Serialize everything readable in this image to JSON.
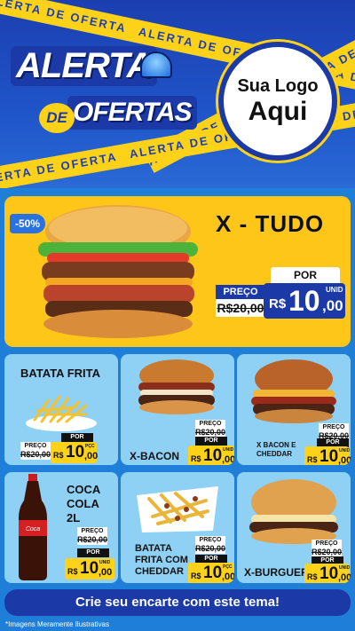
{
  "header": {
    "tape_text": "ALERTA DE OFERTA",
    "title_line1": "ALERTA",
    "title_de": "DE",
    "title_line2": "OFERTAS",
    "logo_line1": "Sua Logo",
    "logo_line2": "Aqui"
  },
  "featured": {
    "discount": "-50%",
    "name": "X - TUDO",
    "por_label": "POR",
    "preco_label": "PREÇO",
    "old_price": "R$20,00",
    "currency": "R$",
    "price_int": "10",
    "price_cents": ",00",
    "unit": "UNID"
  },
  "products": [
    {
      "name": "BATATA FRITA",
      "preco_label": "PREÇO",
      "old_price": "R$20,00",
      "por_label": "POR",
      "currency": "R$",
      "price_int": "10",
      "price_cents": ",00",
      "unit": "PÇC"
    },
    {
      "name": "X-BACON",
      "preco_label": "PREÇO",
      "old_price": "R$20,00",
      "por_label": "POR",
      "currency": "R$",
      "price_int": "10",
      "price_cents": ",00",
      "unit": "UNID"
    },
    {
      "name": "X BACON E CHEDDAR",
      "preco_label": "PREÇO",
      "old_price": "R$20,00",
      "por_label": "POR",
      "currency": "R$",
      "price_int": "10",
      "price_cents": ",00",
      "unit": "UNID"
    },
    {
      "name": "COCA COLA 2L",
      "preco_label": "PREÇO",
      "old_price": "R$20,00",
      "por_label": "POR",
      "currency": "R$",
      "price_int": "10",
      "price_cents": ",00",
      "unit": "UNID"
    },
    {
      "name": "BATATA FRITA COM CHEDDAR",
      "preco_label": "PREÇO",
      "old_price": "R$20,00",
      "por_label": "POR",
      "currency": "R$",
      "price_int": "10",
      "price_cents": ",00",
      "unit": "PÇC"
    },
    {
      "name": "X-BURGUER",
      "preco_label": "PREÇO",
      "old_price": "R$20,00",
      "por_label": "POR",
      "currency": "R$",
      "price_int": "10",
      "price_cents": ",00",
      "unit": "UNID"
    }
  ],
  "footer": {
    "cta": "Crie seu encarte com este tema!",
    "disclaimer": "*Imagens Meramente Ilustrativas"
  },
  "colors": {
    "brand_blue": "#1b3aa8",
    "accent_yellow": "#ffc61a",
    "card_blue": "#8fd0f5"
  }
}
